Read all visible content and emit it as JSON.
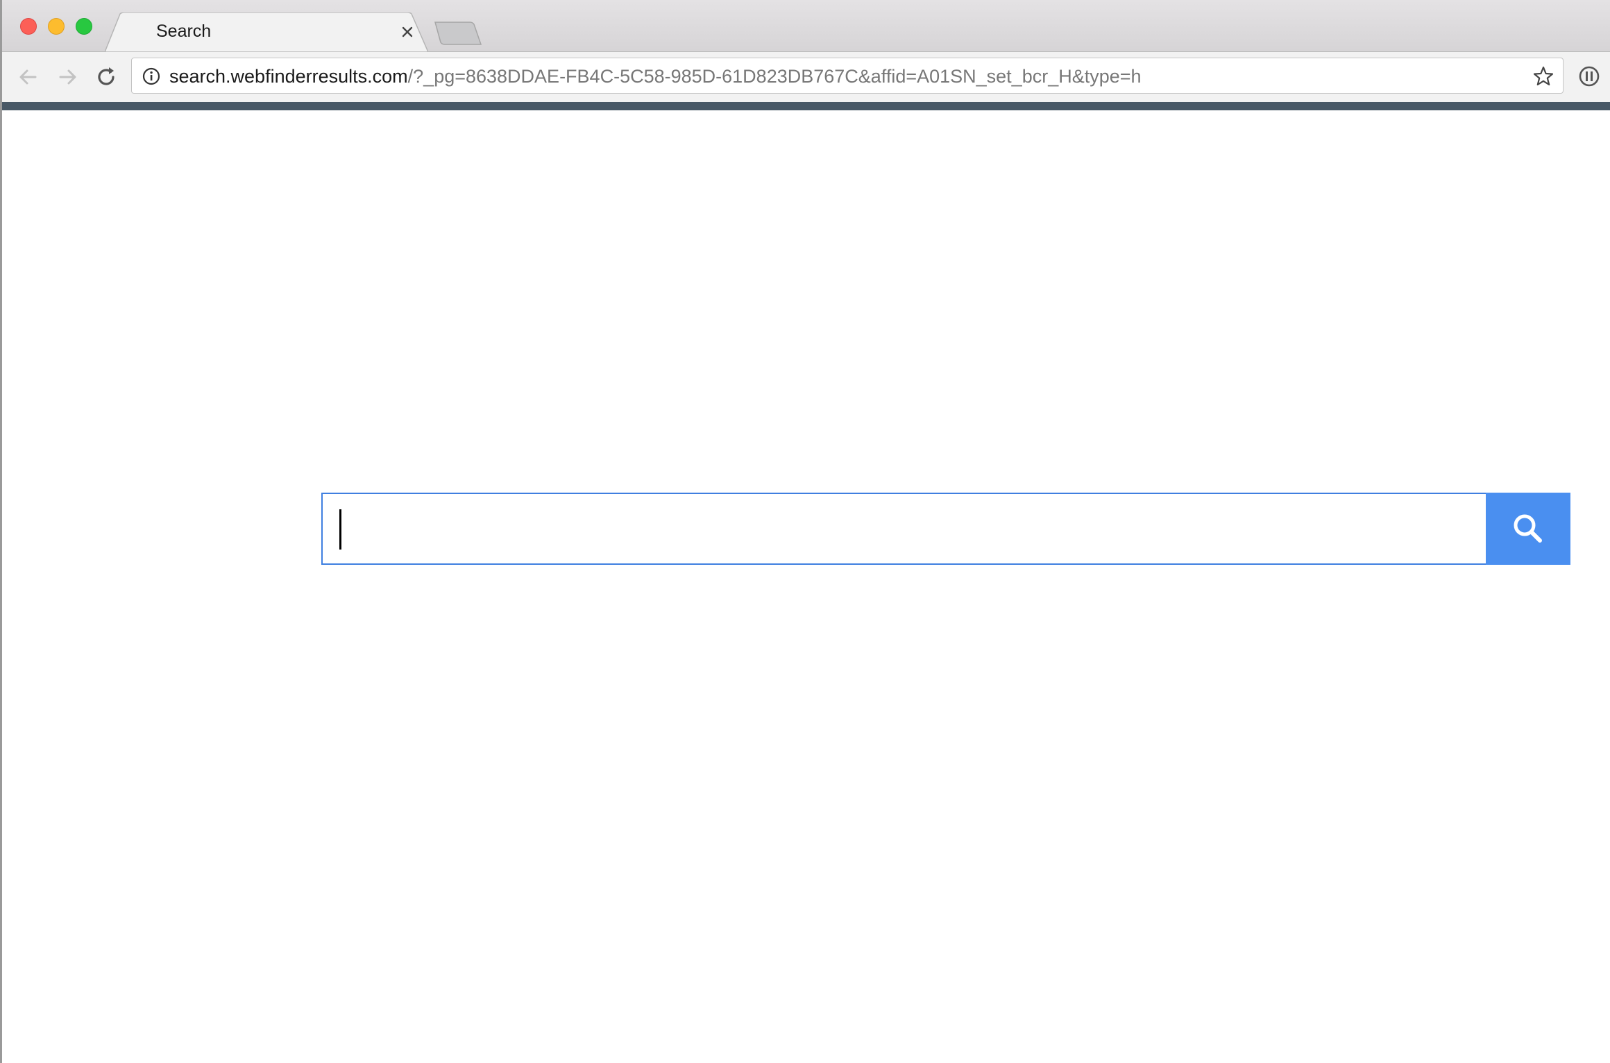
{
  "browser": {
    "tab": {
      "title": "Search"
    },
    "address_bar": {
      "host": "search.webfinderresults.com",
      "path": "/?_pg=8638DDAE-FB4C-5C58-985D-61D823DB767C&affid=A01SN_set_bcr_H&type=h"
    },
    "toolbar_accent_color": "#485866"
  },
  "page": {
    "search": {
      "value": "",
      "button_color": "#4a8ff0",
      "border_color": "#3f7fe0"
    }
  }
}
